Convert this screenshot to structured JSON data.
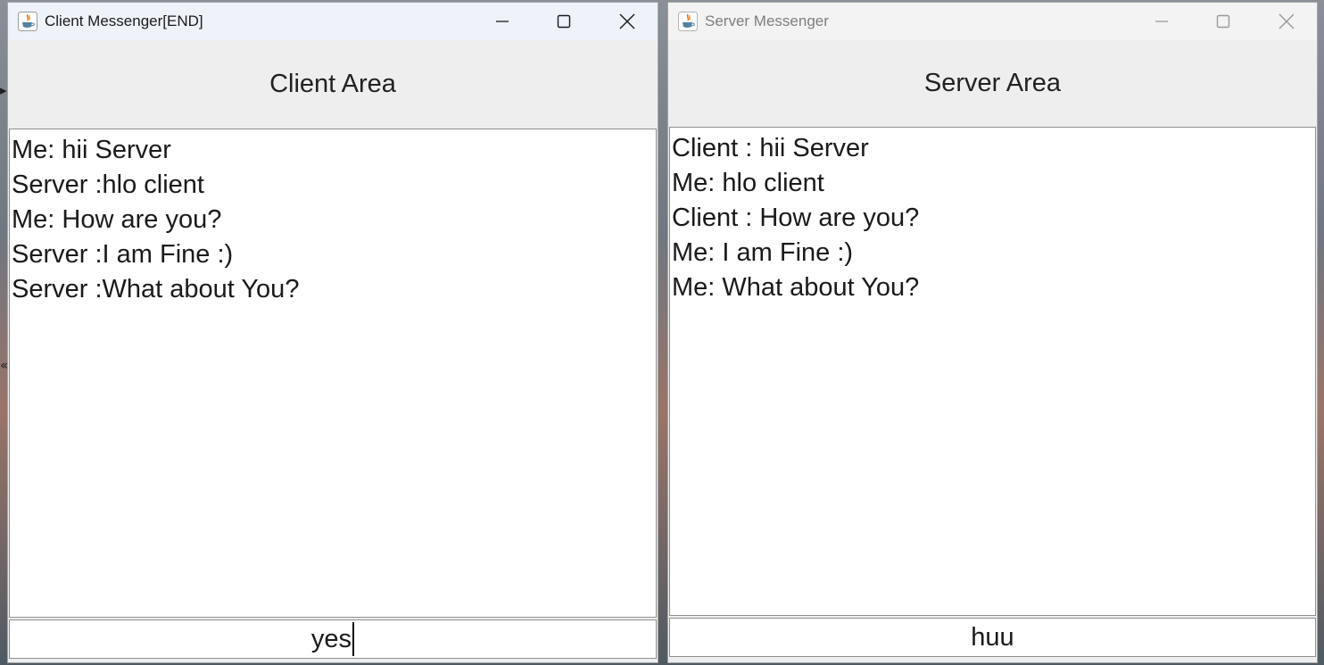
{
  "client_window": {
    "title": "Client Messenger[END]",
    "area_title": "Client Area",
    "messages": [
      "Me: hii Server",
      "Server :hlo client",
      "Me: How are you?",
      "Server :I am Fine :)",
      "Server :What about You?"
    ],
    "input_value": "yes"
  },
  "server_window": {
    "title": "Server Messenger",
    "area_title": "Server Area",
    "messages": [
      "Client : hii Server",
      "Me: hlo client",
      "Client : How are you?",
      "Me: I am Fine :)",
      "Me: What about You?"
    ],
    "input_value": "huu"
  },
  "icons": {
    "app": "java-cup-icon",
    "minimize": "minimize-icon",
    "maximize": "maximize-icon",
    "close": "close-icon"
  },
  "colors": {
    "active_titlebar": "#eef2f9",
    "inactive_titlebar": "#f3f3f3",
    "window_bg": "#eeeeee",
    "chat_bg": "#ffffff",
    "java_icon_red": "#e76f00",
    "java_icon_blue": "#5382a1"
  }
}
